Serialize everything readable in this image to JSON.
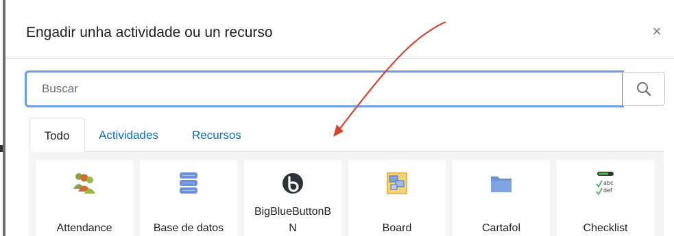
{
  "dialog": {
    "title": "Engadir unha actividade ou un recurso",
    "close_icon": "close-icon"
  },
  "search": {
    "placeholder": "Buscar",
    "value": "",
    "button_icon": "search-icon"
  },
  "tabs": [
    {
      "label": "Todo",
      "active": true
    },
    {
      "label": "Actividades",
      "active": false
    },
    {
      "label": "Recursos",
      "active": false
    }
  ],
  "modules": [
    {
      "label": "Attendance",
      "icon": "attendance-people-icon"
    },
    {
      "label": "Base de datos",
      "icon": "database-icon"
    },
    {
      "label": "BigBlueButtonB\nN",
      "icon": "bigbluebutton-icon"
    },
    {
      "label": "Board",
      "icon": "board-icon"
    },
    {
      "label": "Cartafol",
      "icon": "folder-icon"
    },
    {
      "label": "Checklist",
      "icon": "checklist-icon"
    }
  ],
  "colors": {
    "accent": "#0f6cbf",
    "search_border": "#6b9be0",
    "annotation_arrow": "#d9452b"
  }
}
